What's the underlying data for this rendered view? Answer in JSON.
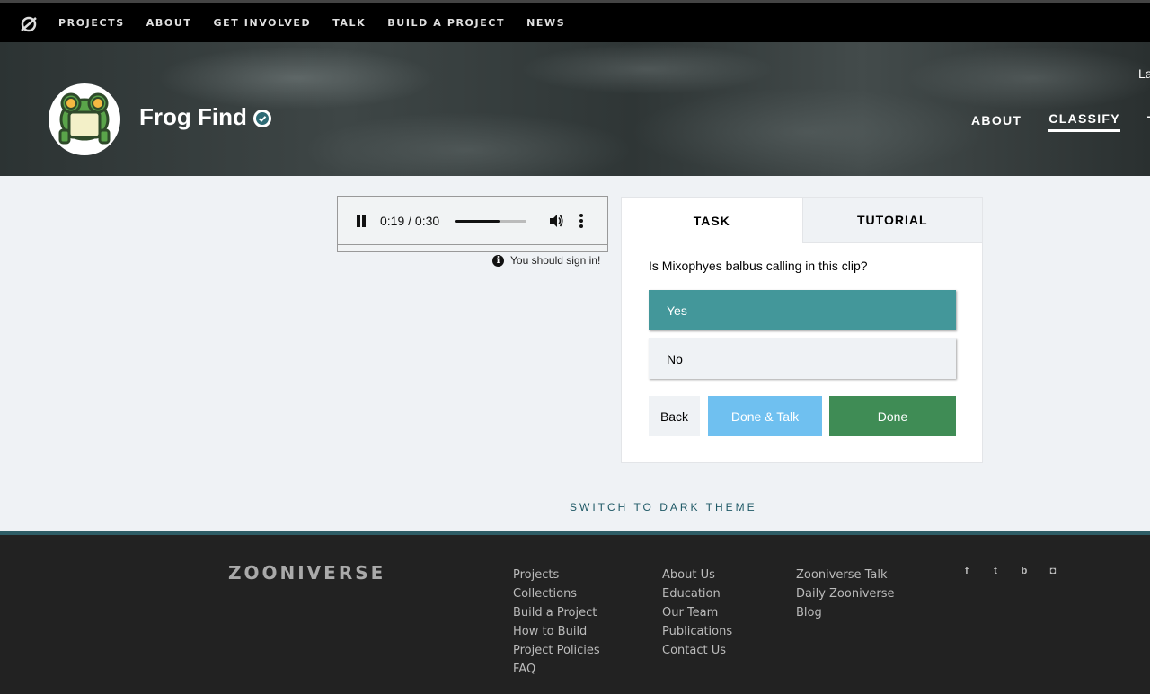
{
  "topnav": {
    "logo_icon": "zooniverse-logo-icon",
    "links": [
      "PROJECTS",
      "ABOUT",
      "GET INVOLVED",
      "TALK",
      "BUILD A PROJECT",
      "NEWS"
    ]
  },
  "project": {
    "title": "Frog Find",
    "avatar_icon": "frog-avatar-icon",
    "verified_icon": "verified-check-icon",
    "lang_stub": "La",
    "nav": [
      "ABOUT",
      "CLASSIFY",
      "T"
    ],
    "active_nav": "CLASSIFY"
  },
  "audio": {
    "time": "0:19 / 0:30",
    "progress": 0.63,
    "play_state_icon": "pause-icon",
    "signin_note": "You should sign in!"
  },
  "task": {
    "tabs": [
      "TASK",
      "TUTORIAL"
    ],
    "question": "Is Mixophyes balbus calling in this clip?",
    "answers": [
      "Yes",
      "No"
    ],
    "selected": "Yes",
    "buttons": {
      "back": "Back",
      "done_talk": "Done & Talk",
      "done": "Done"
    },
    "colors": {
      "selected": "#43979a",
      "done": "#3f8c55",
      "done_talk": "#6fc0f0"
    }
  },
  "theme_switch": "SWITCH TO DARK THEME",
  "footer": {
    "logo": "ZOONIVERSE",
    "col1": [
      "Projects",
      "Collections",
      "Build a Project",
      "How to Build",
      "Project Policies",
      "FAQ"
    ],
    "col2": [
      "About Us",
      "Education",
      "Our Team",
      "Publications",
      "Contact Us"
    ],
    "col3": [
      "Zooniverse Talk",
      "Daily Zooniverse",
      "Blog"
    ],
    "social": [
      {
        "name": "facebook-icon",
        "glyph": "f"
      },
      {
        "name": "twitter-icon",
        "glyph": "t"
      },
      {
        "name": "bluesky-icon",
        "glyph": "b"
      },
      {
        "name": "instagram-icon",
        "glyph": "◘"
      }
    ]
  }
}
